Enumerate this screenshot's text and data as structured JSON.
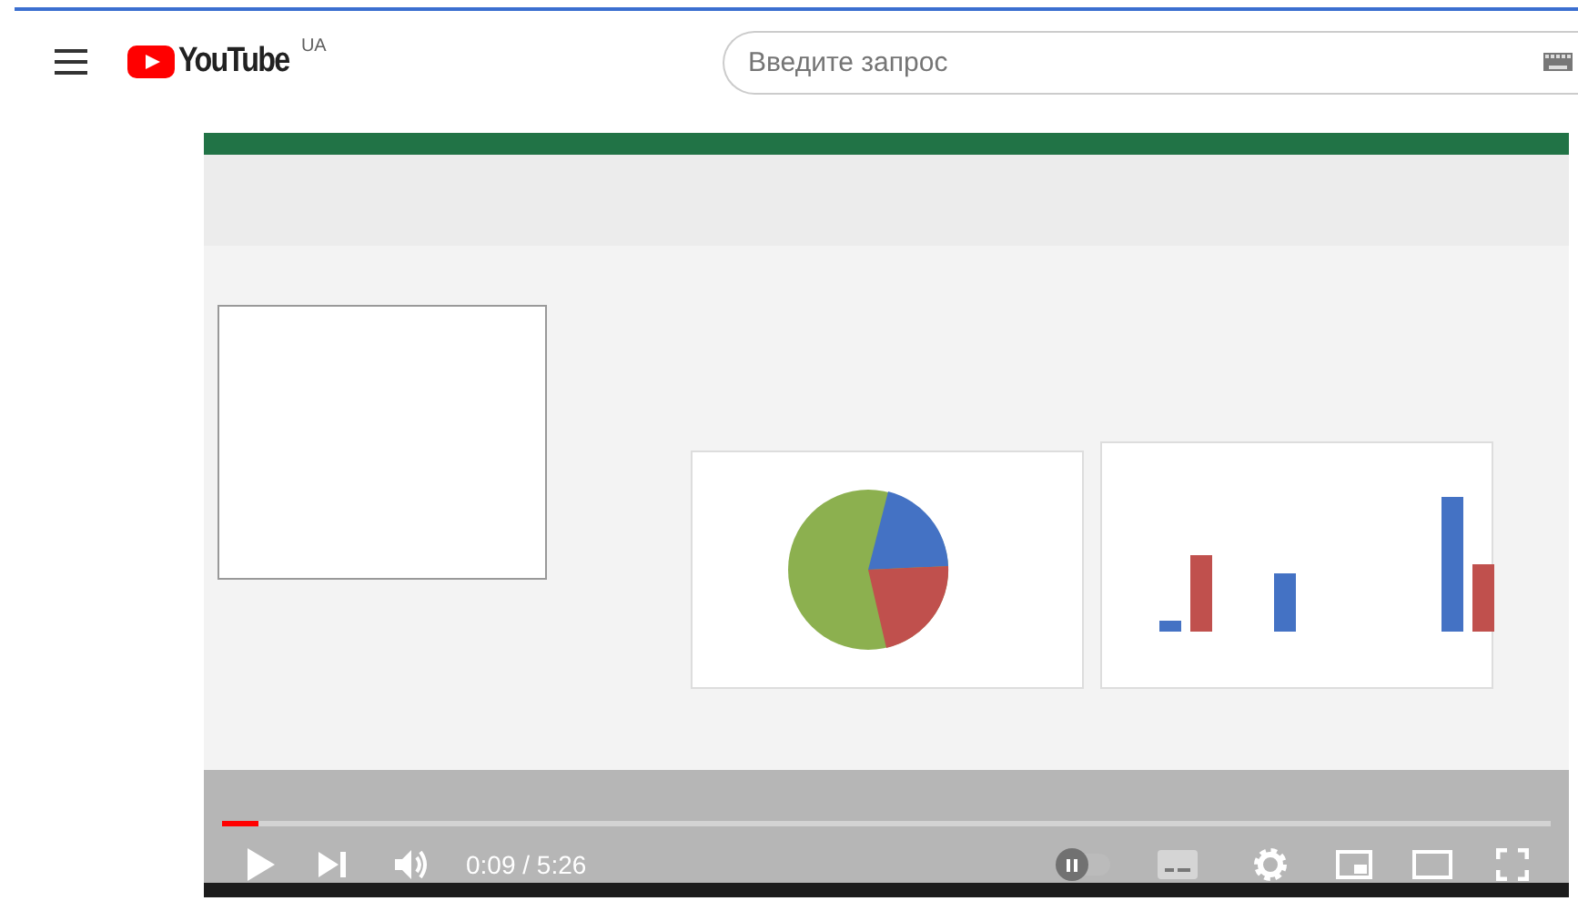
{
  "header": {
    "logo": "YouTube",
    "region": "UA",
    "search": {
      "placeholder": "Введите запрос"
    }
  },
  "player": {
    "kind": "picture",
    "progress": {
      "level": 0.027
    },
    "time": "0:09 / 5:26",
    "autoplay": {
      "on": false
    }
  }
}
